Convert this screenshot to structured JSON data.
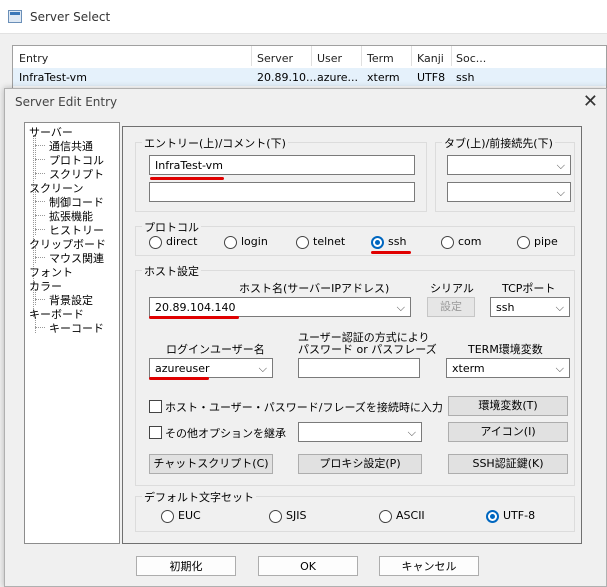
{
  "window": {
    "title": "Server Select"
  },
  "server_list": {
    "columns": [
      "Entry",
      "Server",
      "User",
      "Term",
      "Kanji",
      "Soc..."
    ],
    "rows": [
      [
        "InfraTest-vm",
        "20.89.10...",
        "azure...",
        "xterm",
        "UTF8",
        "ssh"
      ]
    ]
  },
  "dialog": {
    "title": "Server Edit Entry",
    "close": "✕"
  },
  "tree": [
    {
      "label": "サーバー",
      "level": 0
    },
    {
      "label": "通信共通",
      "level": 1
    },
    {
      "label": "プロトコル",
      "level": 1
    },
    {
      "label": "スクリプト",
      "level": 1
    },
    {
      "label": "スクリーン",
      "level": 0
    },
    {
      "label": "制御コード",
      "level": 1
    },
    {
      "label": "拡張機能",
      "level": 1
    },
    {
      "label": "ヒストリー",
      "level": 1
    },
    {
      "label": "クリップボード",
      "level": 0
    },
    {
      "label": "マウス関連",
      "level": 1
    },
    {
      "label": "フォント",
      "level": 0
    },
    {
      "label": "カラー",
      "level": 0
    },
    {
      "label": "背景設定",
      "level": 1
    },
    {
      "label": "キーボード",
      "level": 0
    },
    {
      "label": "キーコード",
      "level": 1
    }
  ],
  "entry": {
    "group_title": "エントリー(上)/コメント(下)",
    "name_value": "InfraTest-vm",
    "comment_value": ""
  },
  "tab": {
    "group_title": "タブ(上)/前接続先(下)",
    "top_value": "",
    "bottom_value": ""
  },
  "protocol": {
    "group_title": "プロトコル",
    "options": [
      "direct",
      "login",
      "telnet",
      "ssh",
      "com",
      "pipe"
    ],
    "selected": "ssh"
  },
  "host": {
    "group_title": "ホスト設定",
    "hostname_label": "ホスト名(サーバーIPアドレス)",
    "hostname_value": "20.89.104.140",
    "serial_label": "シリアル",
    "serial_button": "設定",
    "tcp_label": "TCPポート",
    "tcp_value": "ssh",
    "login_user_label": "ログインユーザー名",
    "login_user_value": "azureuser",
    "auth_label_line1": "ユーザー認証の方式により",
    "auth_label_line2": "パスワード or パスフレーズ",
    "auth_value": "",
    "term_label": "TERM環境変数",
    "term_value": "xterm",
    "save_creds_label": "ホスト・ユーザー・パスワード/フレーズを接続時に入力",
    "env_button": "環境変数(T)",
    "inherit_label": "その他オプションを継承",
    "inherit_value": "",
    "icon_button": "アイコン(I)",
    "chat_button": "チャットスクリプト(C)",
    "proxy_button": "プロキシ設定(P)",
    "ssh_key_button": "SSH認証鍵(K)"
  },
  "charset": {
    "group_title": "デフォルト文字セット",
    "options": [
      "EUC",
      "SJIS",
      "ASCII",
      "UTF-8"
    ],
    "selected": "UTF-8"
  },
  "buttons": {
    "init": "初期化",
    "ok": "OK",
    "cancel": "キャンセル"
  },
  "colors": {
    "accent": "#0067c0",
    "highlight_underline": "#e00000",
    "selection_row": "#e5f1fb"
  }
}
